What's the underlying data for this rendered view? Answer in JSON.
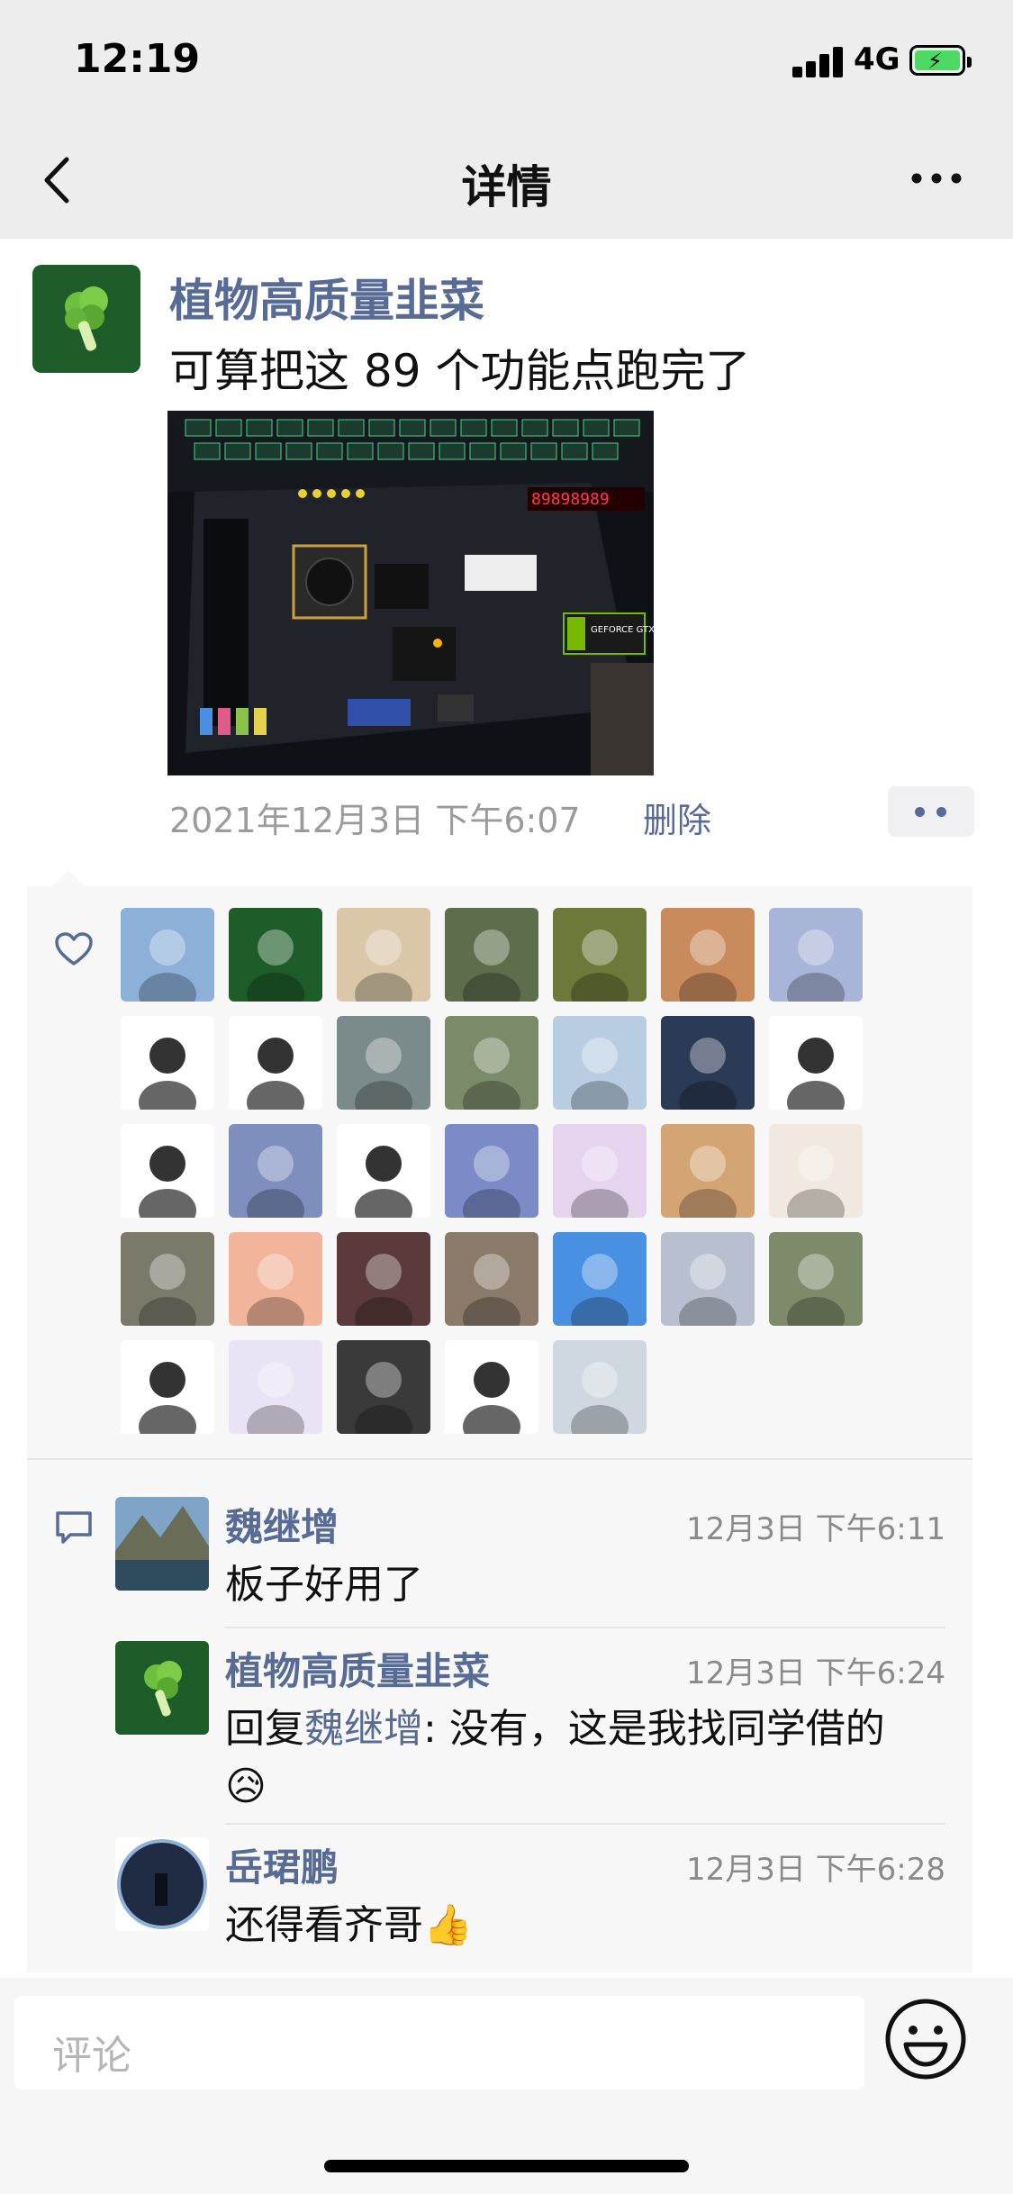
{
  "status": {
    "time": "12:19",
    "network": "4G",
    "battery_color": "#4cd964"
  },
  "nav": {
    "title": "详情",
    "back_icon": "chevron-left-icon",
    "more_icon": "more-dots-icon"
  },
  "post": {
    "author": "植物高质量韭菜",
    "text": "可算把这 89 个功能点跑完了",
    "photo_caption": "GEFORCE GTX",
    "photo_display": "89898989",
    "timestamp": "2021年12月3日 下午6:07",
    "delete_label": "删除"
  },
  "likes": {
    "icon": "heart-icon",
    "count": 33,
    "avatar_colors": [
      "#8db0d8",
      "#1e5c2a",
      "#d9c7a8",
      "#5d6e4c",
      "#6b7a3a",
      "#c98b5c",
      "#a8b4d8",
      "#ffffff",
      "#ffffff",
      "#7b8a8a",
      "#7a8b6a",
      "#b9cde2",
      "#2b3a55",
      "#ffffff",
      "#ffffff",
      "#7e8ebd",
      "#ffffff",
      "#7a8bc7",
      "#e6d3ee",
      "#d4a574",
      "#f1e8df",
      "#7b7a6a",
      "#f2b49a",
      "#5a3a3a",
      "#8a7a6a",
      "#4a90e2",
      "#b8c0d0",
      "#7d8b6a",
      "#ffffff",
      "#e9e3f5",
      "#3a3a3a",
      "#ffffff",
      "#cfd8e0",
      "#6b8aa0"
    ]
  },
  "comments": {
    "icon": "comment-icon",
    "items": [
      {
        "name": "魏继增",
        "time": "12月3日 下午6:11",
        "text": "板子好用了",
        "reply_prefix": "",
        "reply_to": "",
        "reply_sep": "",
        "emoji": ""
      },
      {
        "name": "植物高质量韭菜",
        "time": "12月3日 下午6:24",
        "text": "没有，这是我找同学借的",
        "reply_prefix": "回复",
        "reply_to": "魏继增",
        "reply_sep": ": ",
        "emoji": "😥"
      },
      {
        "name": "岳珺鹏",
        "time": "12月3日 下午6:28",
        "text": "还得看齐哥",
        "reply_prefix": "",
        "reply_to": "",
        "reply_sep": "",
        "emoji": "👍"
      }
    ]
  },
  "input": {
    "placeholder": "评论",
    "emoji_icon": "smiley-icon"
  },
  "colors": {
    "link": "#576b95",
    "panel": "#f7f7f7"
  }
}
